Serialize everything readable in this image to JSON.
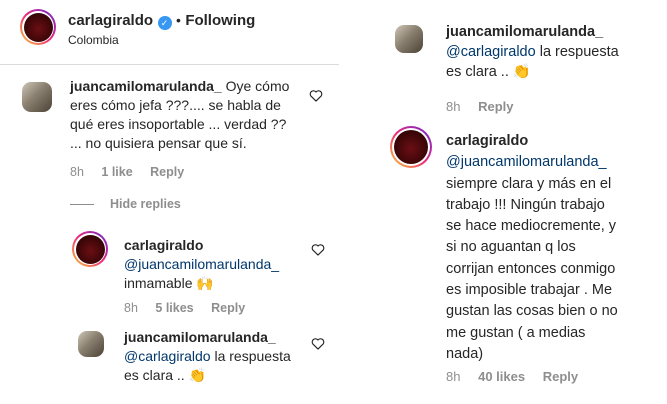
{
  "left": {
    "header": {
      "username": "carlagiraldo",
      "separator": "•",
      "follow_status": "Following",
      "location": "Colombia"
    },
    "comment": {
      "username": "juancamilomarulanda_",
      "lines": [
        "Oye cómo",
        "eres cómo jefa ???.... se habla de",
        "qué eres insoportable ... verdad ??",
        "... no quisiera pensar que sí."
      ],
      "time": "8h",
      "likes": "1 like",
      "reply": "Reply"
    },
    "hide_replies": "Hide replies",
    "reply1": {
      "username": "carlagiraldo",
      "mention": "@juancamilomarulanda_",
      "text": "inmamable 🙌",
      "time": "8h",
      "likes": "5 likes",
      "reply": "Reply"
    },
    "reply2": {
      "username": "juancamilomarulanda_",
      "mention": "@carlagiraldo",
      "text_first": " la respuesta",
      "text_second": "es clara .. 👏"
    }
  },
  "right": {
    "reply_juan": {
      "username": "juancamilomarulanda_",
      "mention": "@carlagiraldo",
      "text_first": " la respuesta",
      "text_second": "es clara .. 👏",
      "time": "8h",
      "reply": "Reply"
    },
    "reply_carla": {
      "username": "carlagiraldo",
      "mention": "@juancamilomarulanda_",
      "lines": [
        "siempre clara y más en el",
        "trabajo !!! Ningún trabajo",
        "se hace mediocremente, y",
        "si no aguantan q los",
        "corrijan entonces conmigo",
        "es imposible trabajar . Me",
        "gustan las cosas bien o no",
        "me gustan ( a medias",
        "nada)"
      ],
      "time": "8h",
      "likes": "40 likes",
      "reply": "Reply"
    }
  },
  "icons": {
    "heart": "heart-outline-icon",
    "verified": "verified-badge-icon"
  }
}
